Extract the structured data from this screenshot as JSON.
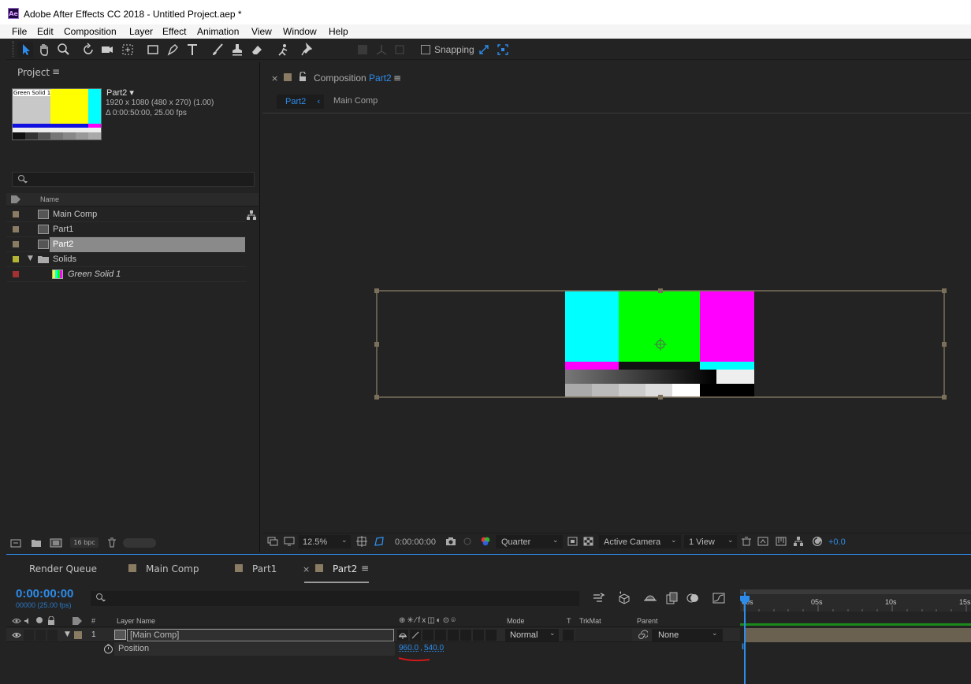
{
  "window": {
    "title": "Adobe After Effects CC 2018 - Untitled Project.aep *",
    "logo": "Ae"
  },
  "menu": [
    "File",
    "Edit",
    "Composition",
    "Layer",
    "Effect",
    "Animation",
    "View",
    "Window",
    "Help"
  ],
  "toolbar": {
    "snapping_label": "Snapping"
  },
  "project": {
    "tab_label": "Project",
    "thumb_label": "Green Solid 1",
    "selected_name": "Part2",
    "info_line1": "1920 x 1080  (480 x 270) (1.00)",
    "info_line2": "Δ 0:00:50:00, 25.00 fps",
    "search_placeholder": "",
    "col_name": "Name",
    "items": [
      {
        "name": "Main Comp",
        "label_color": "#8a7b63"
      },
      {
        "name": "Part1",
        "label_color": "#8a7b63"
      },
      {
        "name": "Part2",
        "label_color": "#8a7b63"
      },
      {
        "name": "Solids",
        "label_color": "#b4b433"
      },
      {
        "name": "Green Solid 1",
        "label_color": "#a13232"
      }
    ],
    "bpc": "16 bpc"
  },
  "comp": {
    "tab_prefix": "Composition",
    "tab_name": "Part2",
    "breadcrumb_current": "Part2",
    "breadcrumb_parent": "Main Comp",
    "zoom": "12.5%",
    "timecode": "0:00:00:00",
    "resolution": "Quarter",
    "camera": "Active Camera",
    "views": "1 View",
    "exposure": "+0.0"
  },
  "timeline": {
    "tabs": [
      "Render Queue",
      "Main Comp",
      "Part1",
      "Part2"
    ],
    "timecode": "0:00:00:00",
    "frames": "00000 (25.00 fps)",
    "col_layer_name": "Layer Name",
    "col_mode": "Mode",
    "col_t": "T",
    "col_trkmat": "TrkMat",
    "col_parent": "Parent",
    "layer_index": "1",
    "layer_name": "[Main Comp]",
    "layer_mode": "Normal",
    "layer_parent": "None",
    "property_name": "Position",
    "position_x": "960.0",
    "position_y": "540.0",
    "ruler": [
      "00s",
      "05s",
      "10s",
      "15s"
    ]
  },
  "colors": {
    "accent": "#2d8ceb",
    "bg": "#232323",
    "layer_bar": "#6b6150"
  }
}
